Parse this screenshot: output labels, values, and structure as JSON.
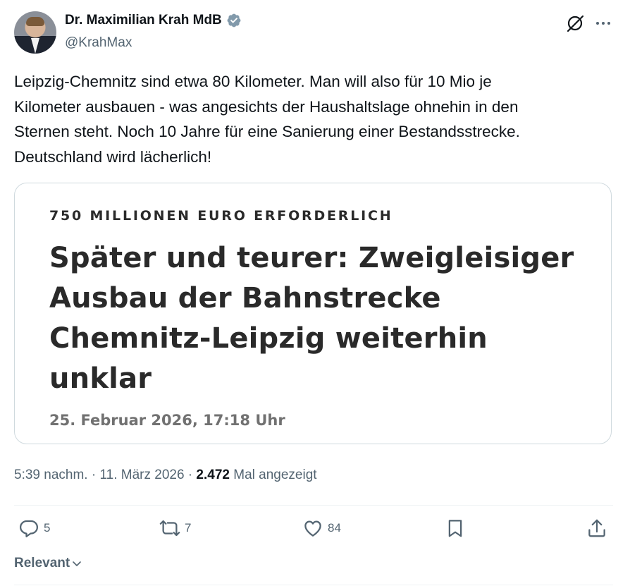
{
  "author": {
    "name": "Dr. Maximilian Krah MdB",
    "handle": "@KrahMax"
  },
  "tweet": {
    "text": "Leipzig-Chemnitz sind etwa 80 Kilometer. Man will also für 10 Mio je\nKilometer ausbauen - was angesichts der Haushaltslage ohnehin in den\nSternen steht. Noch 10 Jahre für eine Sanierung einer Bestandsstrecke.\nDeutschland wird lächerlich!"
  },
  "card": {
    "kicker": "750 MILLIONEN EURO ERFORDERLICH",
    "headline": "Später und teurer: Zweigleisiger\nAusbau der Bahnstrecke\nChemnitz-Leipzig weiterhin\nunklar",
    "date": "25. Februar 2026, 17:18 Uhr"
  },
  "meta": {
    "time": "5:39 nachm.",
    "sep1": " · ",
    "date": "11. März 2026",
    "sep2": " · ",
    "views": "2.472",
    "views_label": " Mal angezeigt"
  },
  "actions": {
    "replies": "5",
    "reposts": "7",
    "likes": "84"
  },
  "sort": {
    "label": "Relevant"
  },
  "icons": {
    "verified": "verified-badge-icon",
    "grok": "grok-icon",
    "more": "more-icon",
    "reply": "reply-icon",
    "repost": "repost-icon",
    "like": "heart-icon",
    "bookmark": "bookmark-icon",
    "share": "share-icon",
    "chevron": "chevron-down-icon"
  },
  "colors": {
    "text": "#0f1419",
    "secondary": "#536471",
    "border": "#cfd9de",
    "verified": "#829aab"
  }
}
